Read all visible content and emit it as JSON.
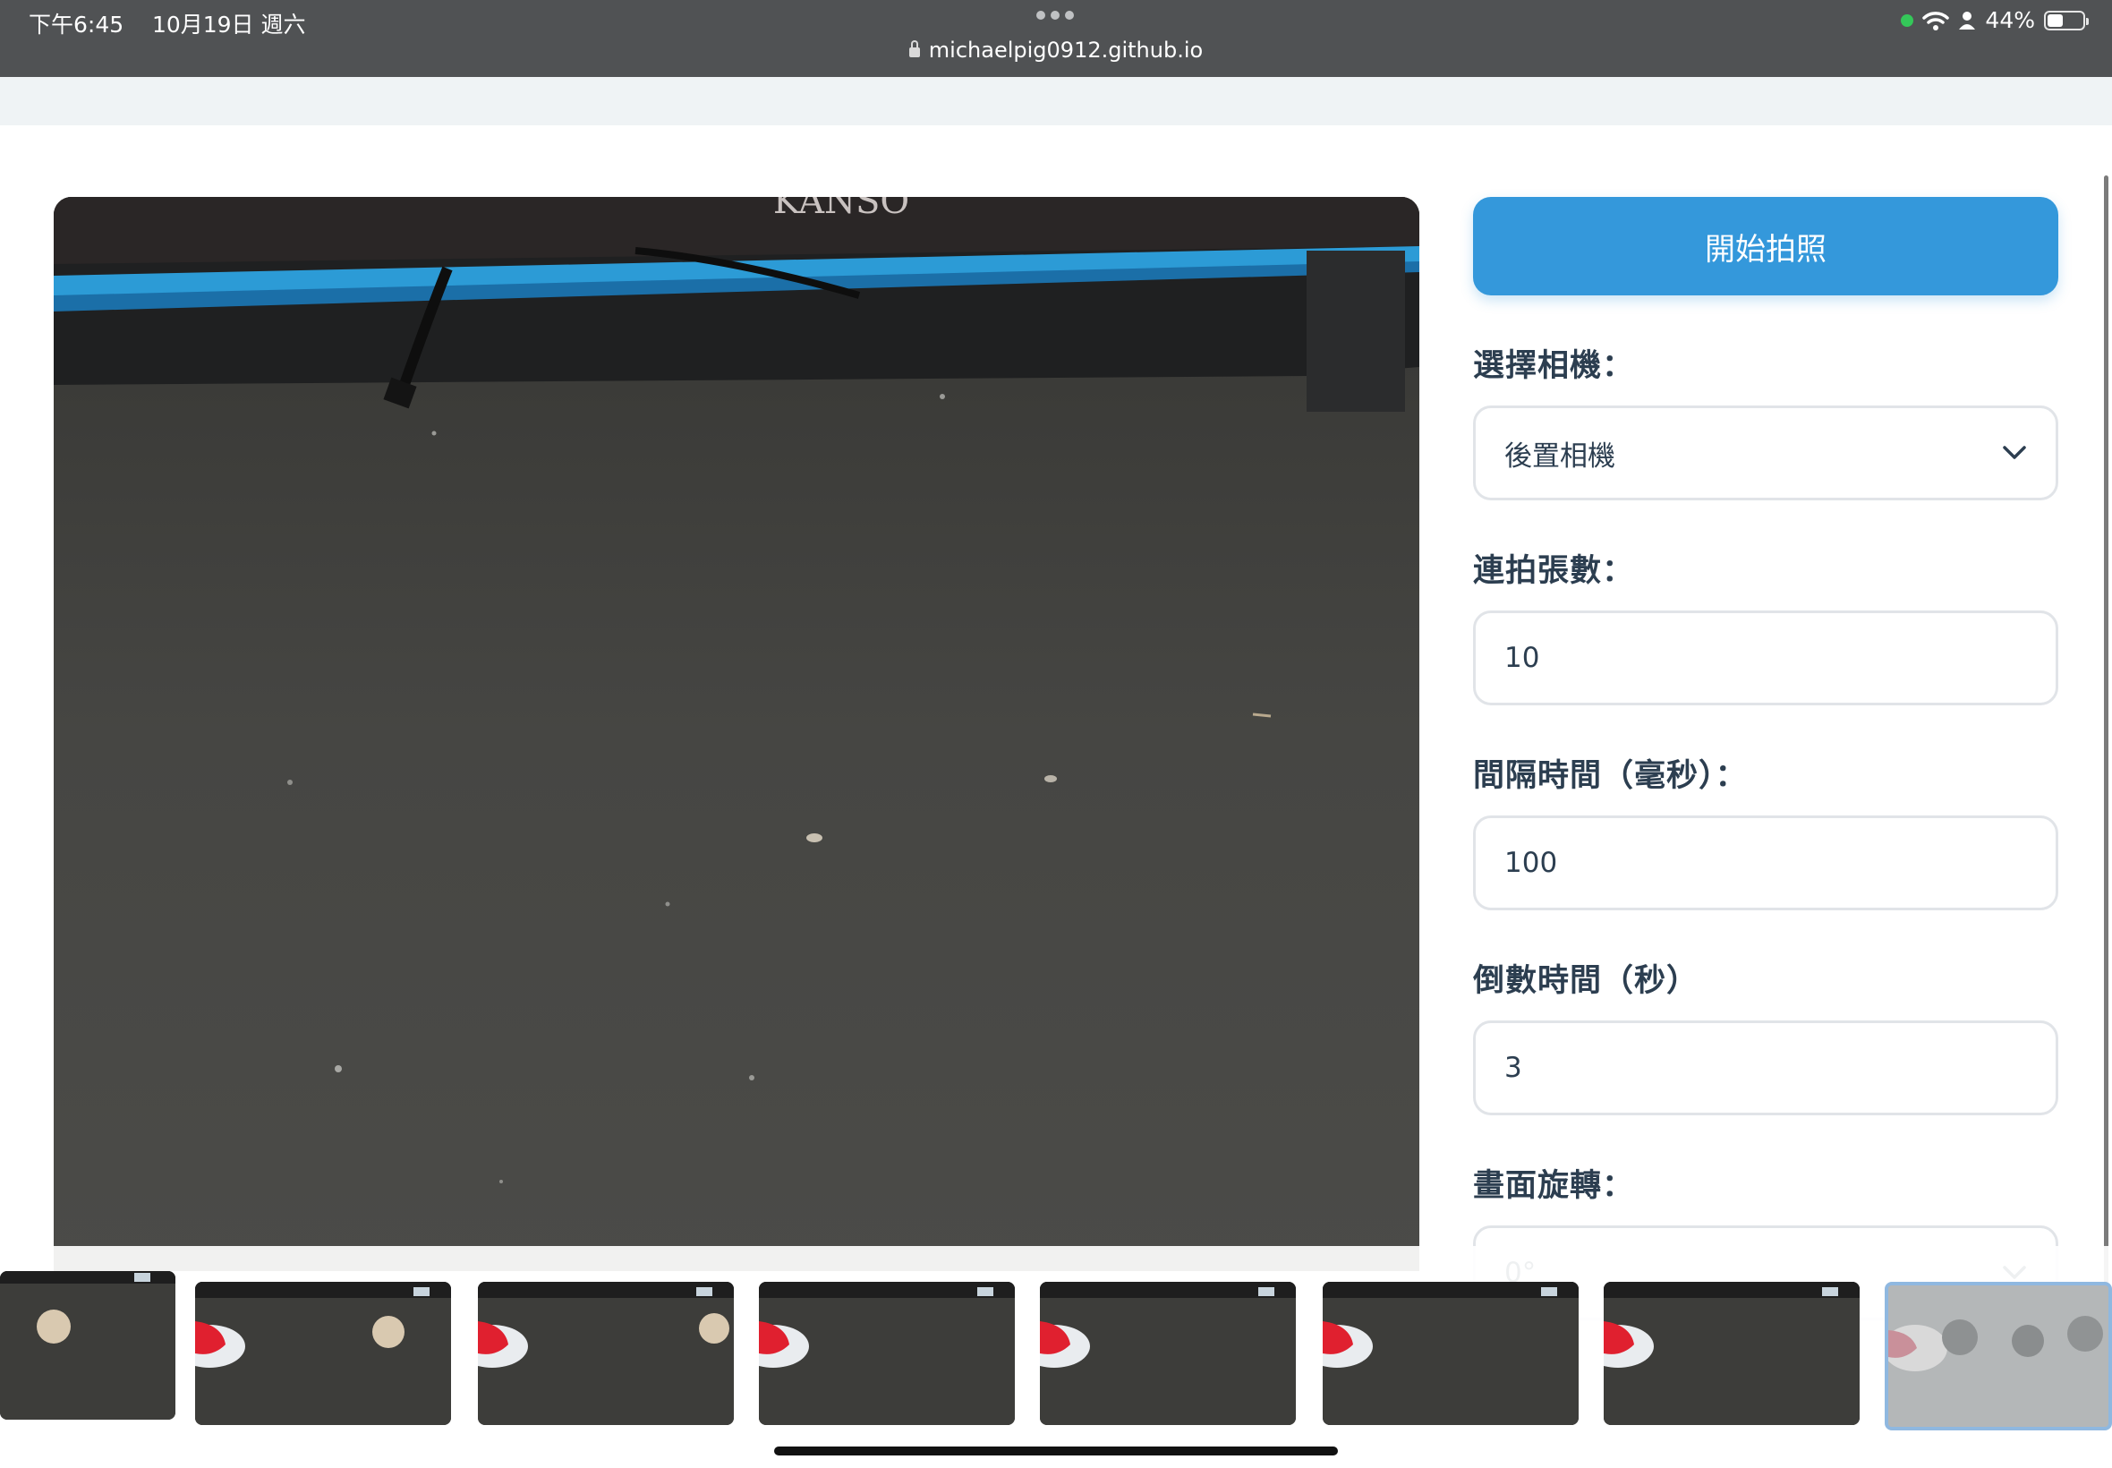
{
  "status_bar": {
    "time": "下午6:45",
    "date": "10月19日 週六",
    "url": "michaelpig0912.github.io",
    "battery": "44%",
    "battery_level": 0.44
  },
  "preview": {
    "brand_text": "KANSO"
  },
  "controls": {
    "start_button": "開始拍照",
    "camera_label": "選擇相機：",
    "camera_value": "後置相機",
    "burst_label": "連拍張數：",
    "burst_value": "10",
    "interval_label": "間隔時間（毫秒）：",
    "interval_value": "100",
    "countdown_label": "倒數時間（秒）",
    "countdown_value": "3",
    "rotation_label": "畫面旋轉：",
    "rotation_value": "0°"
  },
  "colors": {
    "accent": "#3498db",
    "label": "#2c3e50",
    "border": "#e1e4e8"
  },
  "thumbnails": [
    {
      "content": "ball"
    },
    {
      "content": "red-object-ball"
    },
    {
      "content": "red-object-ball"
    },
    {
      "content": "red-object"
    },
    {
      "content": "red-object"
    },
    {
      "content": "red-object"
    },
    {
      "content": "red-object"
    },
    {
      "content": "multi-ball",
      "selected": true
    }
  ]
}
